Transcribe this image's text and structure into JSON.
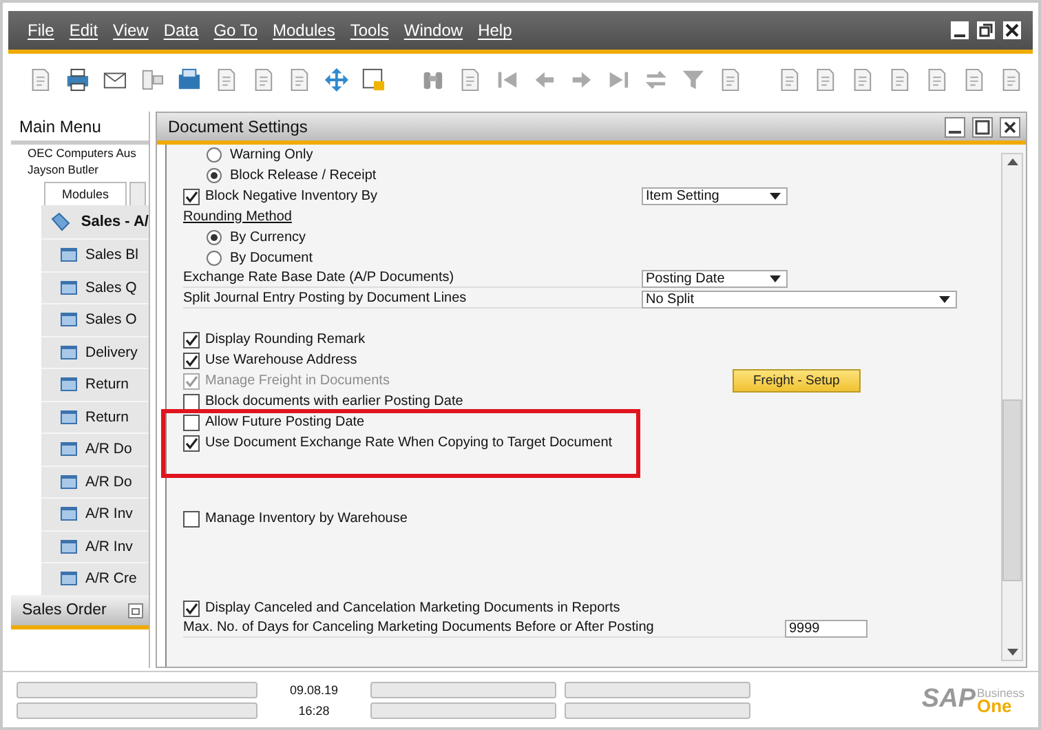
{
  "menu_bar": {
    "items": [
      "File",
      "Edit",
      "View",
      "Data",
      "Go To",
      "Modules",
      "Tools",
      "Window",
      "Help"
    ]
  },
  "main_menu": {
    "title": "Main Menu",
    "company": "OEC Computers Aus",
    "user": "Jayson Butler",
    "tabs": [
      {
        "label": "Modules",
        "selected": true
      }
    ],
    "module": "Sales - A/",
    "items": [
      "Sales Bl",
      "Sales Q",
      "Sales O",
      "Delivery",
      "Return",
      "Return",
      "A/R Do",
      "A/R Do",
      "A/R Inv",
      "A/R Inv",
      "A/R Cre"
    ],
    "footer": "Sales Order"
  },
  "document_window": {
    "title": "Document Settings",
    "sections": [
      {
        "rows": [
          {
            "kind": "radio",
            "label": "Warning Only",
            "selected": false
          },
          {
            "kind": "radio",
            "label": "Block Release / Receipt",
            "selected": true
          },
          {
            "kind": "checkbox",
            "label": "Block Negative Inventory By",
            "checked": true,
            "disabled": false,
            "select": "Item Setting"
          },
          {
            "kind": "heading",
            "label": "Rounding Method"
          },
          {
            "kind": "radio",
            "label": "By Currency",
            "selected": true
          },
          {
            "kind": "radio",
            "label": "By Document",
            "selected": false
          },
          {
            "kind": "select",
            "label": "Exchange Rate Base Date (A/P Documents)",
            "select": "Posting Date"
          },
          {
            "kind": "select",
            "label": "Split Journal Entry Posting by Document Lines",
            "select": "No Split",
            "wide": true
          }
        ]
      },
      {
        "rows": [
          {
            "kind": "checkbox",
            "label": "Display Rounding Remark",
            "checked": true,
            "disabled": false
          },
          {
            "kind": "checkbox",
            "label": "Use Warehouse Address",
            "checked": true,
            "disabled": false
          },
          {
            "kind": "checkbox",
            "label": "Manage Freight in Documents",
            "checked": true,
            "disabled": true,
            "button": "Freight - Setup"
          },
          {
            "kind": "checkbox",
            "label": "Block documents with earlier Posting Date",
            "checked": false,
            "disabled": false
          },
          {
            "kind": "checkbox",
            "label": "Allow Future Posting Date",
            "checked": false,
            "disabled": false
          },
          {
            "kind": "checkbox",
            "label": "Use Document Exchange Rate When Copying to Target Document",
            "checked": true,
            "disabled": false
          }
        ]
      },
      {
        "rows": [
          {
            "kind": "checkbox",
            "label": "Manage Inventory by Warehouse",
            "checked": false,
            "disabled": false
          }
        ]
      },
      {
        "rows": [
          {
            "kind": "checkbox",
            "label": "Display Canceled and Cancelation Marketing Documents in Reports",
            "checked": true,
            "disabled": false
          },
          {
            "kind": "input",
            "label": "Max. No. of Days for Canceling Marketing Documents Before or After Posting",
            "value": "9999"
          }
        ]
      }
    ]
  },
  "status_bar": {
    "date": "09.08.19",
    "time": "16:28",
    "logo": {
      "brand": "SAP",
      "line_1": "Business",
      "line_2": "One"
    }
  }
}
